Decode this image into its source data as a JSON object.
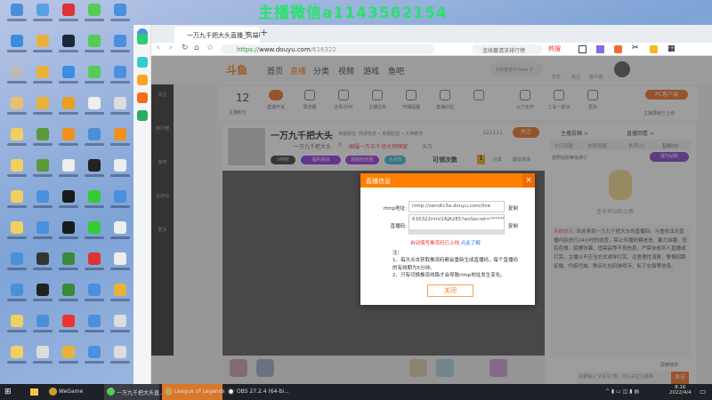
{
  "watermark": "主播微信a1143562154",
  "desktop": {
    "icon_colors": [
      "#4a90d9",
      "#5aa0e0",
      "#d33",
      "#5c5",
      "#4a8fe0",
      "#3b8de0",
      "#e8b23a",
      "#1b2838",
      "#5c5",
      "#4a8fe0",
      "#bbb",
      "#e8b23a",
      "#3a8ee6",
      "#5c5",
      "#4a8fe0",
      "#e8c070",
      "#e8b23a",
      "#e8a020",
      "#eee",
      "#ddd",
      "#f0d060",
      "#5a9a3a",
      "#f09020",
      "#4a90d9",
      "#f09020",
      "#f0d060",
      "#5a9a3a",
      "#eee",
      "#222",
      "#eee",
      "#f0d060",
      "#4a8fe0",
      "#1a1a1a",
      "#3c3",
      "#4a8fe0",
      "#f0d060",
      "#4a8fe0",
      "#1a1a1a",
      "#3c3",
      "#eee",
      "#4a90d9",
      "#333",
      "#3a8a3a",
      "#d33",
      "#eee",
      "#4a90d9",
      "#222",
      "#3a8a3a",
      "#4a8fe0",
      "#e8b23a",
      "#f0d060",
      "#4a90d9",
      "#e33",
      "#4a8fe0",
      "#ddd",
      "#f0d060",
      "#ddd",
      "#e8b23a",
      "#4a8fe0",
      "#ddd"
    ]
  },
  "browser": {
    "tab_title": "一万九千把大头直播_高端联盟",
    "url_scheme": "https://",
    "url_host": "www.douyu.com",
    "url_path": "/616322",
    "search_placeholder": "连续赢请求排行榜",
    "hot_label": "热搜",
    "sidebar_colors": [
      "#2ecc71",
      "#3cc",
      "#f5a623",
      "#f76b1c",
      "#27ae60"
    ]
  },
  "douyu": {
    "logo": "斗鱼",
    "nav": [
      "首页",
      "直播",
      "分类",
      "视频",
      "游戏",
      "鱼吧"
    ],
    "search_placeholder": "卡布奇诺不Tasia",
    "header_icons": [
      "历史",
      "关注",
      "客户端"
    ],
    "leftnav": [
      "关注",
      "排行榜",
      "鱼吧",
      "云游戏",
      "更多"
    ],
    "score": "12",
    "score_label": "主播积分",
    "tools": [
      "直播开关",
      "录流器",
      "全民乐PK",
      "主播任务",
      "开播提醒",
      "直播红包",
      "",
      "火力全开",
      "上车一起玩",
      "更多"
    ],
    "pc_client": "PC客户端",
    "pc_client_sub": "主播录制已上线",
    "room": {
      "name": "一万九千把大头",
      "category": "英雄联盟",
      "tags": "网游竞技 • 英雄联盟 • 大神教学",
      "subname": "一万九千把大头",
      "fans": "0",
      "hot": "国服一万五千场大师牌家",
      "count_label": "未万",
      "followers": "321111",
      "follow": "关注",
      "badges": [
        "V特权",
        "福利挑战",
        "超级粉丝团",
        "大吊司"
      ],
      "chances": "可领次数",
      "chances_n": "1",
      "share": "分享",
      "report": "建议反馈"
    },
    "right": {
      "links": [
        "主播投稿 >",
        "直播回看 >"
      ],
      "tabs": [
        "今日贡献",
        "本周贡献",
        "贵宾(1)",
        "钻粉(0)"
      ],
      "rank_hint": "按照钻粉等级排行",
      "join": "成为钻粉",
      "empty": "还未有钻粉上榜",
      "notice_title": "系统提示:",
      "notice": "欢迎来到一万九千把大头的直播间。斗鱼依法对直播内容进行24小时的巡查，禁止传播封建迷信、暴力血腥、低俗色情、招嫖诈骗、违禁品等不良信息。严禁未成年人直播或打赏。主播以不正当方式诱导打赏，注意理性消费，警惕招聘征婚、代练代抽、购买礼包码游戏币、私下交易等信息。",
      "block": "屏蔽特效",
      "input_placeholder": "试着输入\"#关注\"吧，可以关注主播哦",
      "send": "发送"
    }
  },
  "dialog": {
    "title": "直播信息",
    "rtmp_label": "rtmp地址:",
    "rtmp_value": "rtmp://sendtc3a.douyu.com/live",
    "code_label": "直播码:",
    "code_value": "616322rmV2AJA2E5?wsSecret=***********",
    "copy": "复制",
    "auto_fill": "自动填写推流码已上线,",
    "learn_more": "点此了解",
    "note_title": "注：",
    "notes": [
      "1、每次点击获取推流码都会重新生成直播码，每个直播码的有效期为5分钟。",
      "2、只有切换推流线路才会导致rtmp地址发生变化。"
    ],
    "close": "关闭"
  },
  "taskbar": {
    "items": [
      "WeGame",
      "一万九千把大头直...",
      "League of Legends",
      "OBS 27.2.4 (64-bi..."
    ],
    "time": "8:16",
    "date": "2022/4/4"
  }
}
